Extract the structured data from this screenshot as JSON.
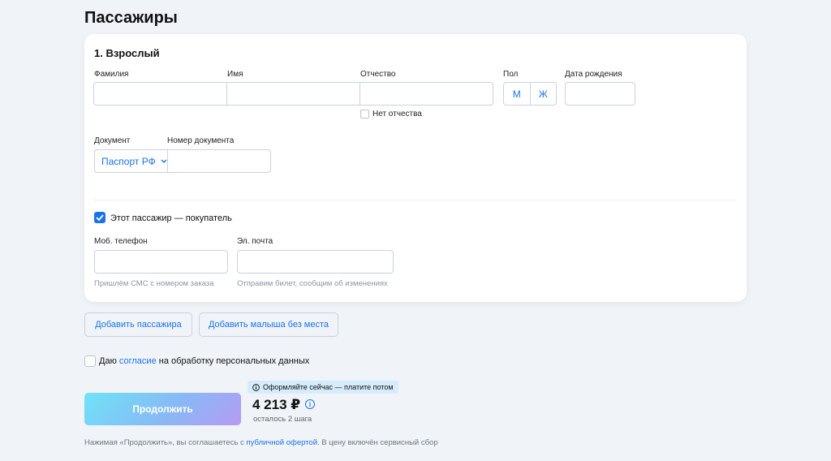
{
  "page": {
    "title": "Пассажиры"
  },
  "passenger": {
    "title": "1. Взрослый",
    "labels": {
      "last_name": "Фамилия",
      "first_name": "Имя",
      "patronymic": "Отчество",
      "gender": "Пол",
      "birth_date": "Дата рождения",
      "document": "Документ",
      "document_number": "Номер документа",
      "phone": "Моб. телефон",
      "email": "Эл. почта"
    },
    "values": {
      "last_name": "",
      "first_name": "",
      "patronymic": "",
      "birth_date": "",
      "document_number": "",
      "phone": "",
      "email": ""
    },
    "gender_options": {
      "male": "М",
      "female": "Ж"
    },
    "no_patronymic": "Нет отчества",
    "document_selected": "Паспорт РФ",
    "buyer_label": "Этот пассажир — покупатель",
    "buyer_checked": true,
    "phone_hint": "Пришлём СМС с номером заказа",
    "email_hint": "Отправим билет, сообщим об изменениях"
  },
  "actions": {
    "add_passenger": "Добавить пассажира",
    "add_infant": "Добавить малыша без места"
  },
  "consent": {
    "prefix": "Даю ",
    "link": "согласие",
    "suffix": " на обработку персональных данных"
  },
  "checkout": {
    "continue": "Продолжить",
    "bnpl_badge": "Оформляйте сейчас — платите потом",
    "price": "4 213 ₽",
    "steps_left": "осталось 2 шага"
  },
  "footer": {
    "prefix": "Нажимая «Продолжить», вы соглашаетесь с ",
    "link": "публичной офертой",
    "suffix": ". В цену включён сервисный сбор"
  },
  "colors": {
    "accent": "#1a73e8",
    "background": "#f0f3f7",
    "hint": "#8a96a3"
  }
}
